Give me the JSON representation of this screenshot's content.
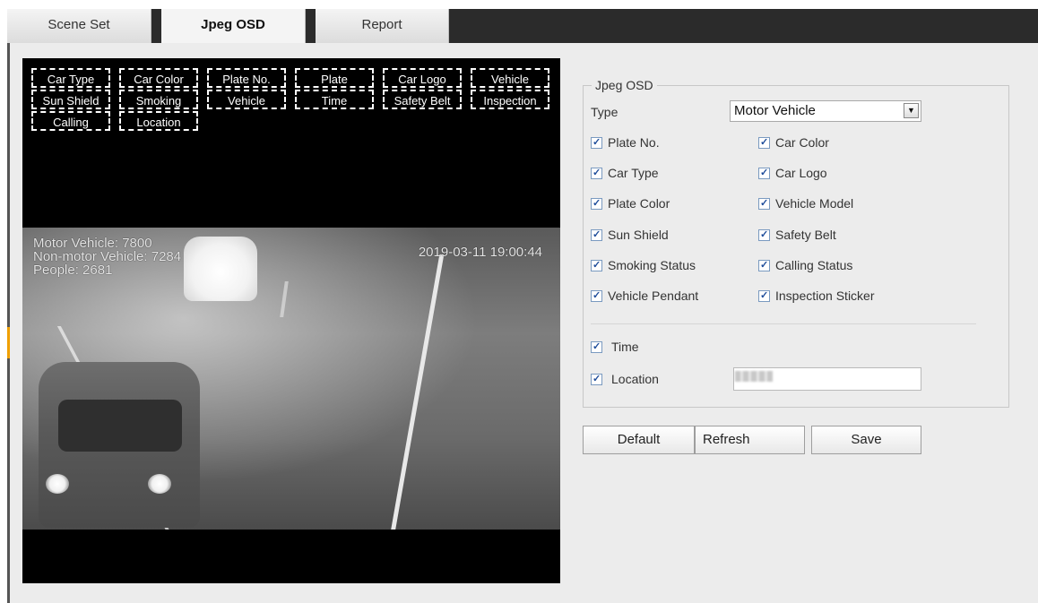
{
  "tabs": [
    {
      "label": "Scene Set",
      "active": false
    },
    {
      "label": "Jpeg OSD",
      "active": true
    },
    {
      "label": "Report",
      "active": false
    }
  ],
  "preview": {
    "osd_items": [
      "Car Type",
      "Car Color",
      "Plate No.",
      "Plate",
      "Car Logo",
      "Vehicle",
      "Sun Shield",
      "Smoking",
      "Vehicle",
      "Time",
      "Safety Belt",
      "Inspection",
      "Calling",
      "Location"
    ],
    "overlay_lines": [
      "Motor Vehicle: 7800",
      "Non-motor Vehicle: 7284",
      "People: 2681"
    ],
    "timestamp": "2019-03-11 19:00:44"
  },
  "panel": {
    "legend": "Jpeg OSD",
    "type_label": "Type",
    "type_value": "Motor Vehicle",
    "checkboxes": [
      {
        "label": "Plate No.",
        "checked": true
      },
      {
        "label": "Car Color",
        "checked": true
      },
      {
        "label": "Car Type",
        "checked": true
      },
      {
        "label": "Car Logo",
        "checked": true
      },
      {
        "label": "Plate Color",
        "checked": true
      },
      {
        "label": "Vehicle Model",
        "checked": true
      },
      {
        "label": "Sun Shield",
        "checked": true
      },
      {
        "label": "Safety Belt",
        "checked": true
      },
      {
        "label": "Smoking Status",
        "checked": true
      },
      {
        "label": "Calling Status",
        "checked": true
      },
      {
        "label": "Vehicle Pendant",
        "checked": true
      },
      {
        "label": "Inspection Sticker",
        "checked": true
      }
    ],
    "time_label": "Time",
    "location_label": "Location"
  },
  "buttons": {
    "default": "Default",
    "refresh": "Refresh",
    "save": "Save"
  }
}
